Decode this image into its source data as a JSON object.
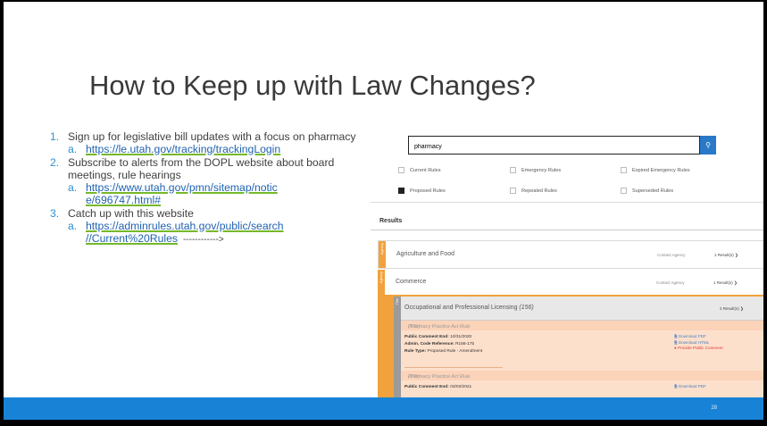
{
  "slide": {
    "title": "How to Keep up with Law Changes?",
    "page_number": "28",
    "items": [
      {
        "num": "1.",
        "text": "Sign up for legislative bill updates with a focus on pharmacy",
        "sub_num": "a.",
        "link": "https://le.utah.gov/tracking/trackingLogin"
      },
      {
        "num": "2.",
        "text": "Subscribe to alerts from the DOPL website about board meetings, rule hearings",
        "sub_num": "a.",
        "link_line1": "https://www.utah.gov/pmn/sitemap/notic",
        "link_line2": "e/696747.html#"
      },
      {
        "num": "3.",
        "text": "Catch up with this website",
        "sub_num": "a.",
        "link_line1": "https://adminrules.utah.gov/public/search",
        "link_line2": "//Current%20Rules",
        "arrow": "------------>"
      }
    ]
  },
  "screenshot": {
    "search_value": "pharmacy",
    "search_icon": "search-icon",
    "checkboxes": [
      {
        "label": "Current Rules",
        "checked": false
      },
      {
        "label": "Emergency Rules",
        "checked": false
      },
      {
        "label": "Expired Emergency Rules",
        "checked": false
      },
      {
        "label": "Proposed Rules",
        "checked": true
      },
      {
        "label": "Repealed Rules",
        "checked": false
      },
      {
        "label": "Superseded Rules",
        "checked": false
      }
    ],
    "results_heading": "Results",
    "agency_tab_label": "Agency",
    "title_tab_label": "Title",
    "agencies": [
      {
        "name": "Agriculture and Food",
        "contact": "Contact Agency",
        "count": "1 Result(s)"
      },
      {
        "name": "Commerce",
        "contact": "Contact Agency",
        "count": "1 Result(s)"
      }
    ],
    "sub_agency": {
      "name": "Occupational and Professional Licensing",
      "count_inline": "(156)",
      "count": "2 Result(s)"
    },
    "rules": [
      {
        "title": "Pharmacy Practice Act Rule",
        "code_inline": "(17b)",
        "comment_label": "Public Comment End:",
        "comment_end": "10/31/2020",
        "ref_label": "Admin. Code Reference:",
        "ref": "R156-17b",
        "type_label": "Rule Type:",
        "type": "Proposed Rule - Amendment",
        "actions": [
          "Download PDF",
          "Download HTML",
          "Provide Public Comment"
        ]
      },
      {
        "title": "Pharmacy Practice Act Rule",
        "code_inline": "(17b)",
        "comment_label": "Public Comment End:",
        "comment_end": "03/03/2021",
        "actions": [
          "Download PDF"
        ]
      }
    ]
  },
  "colors": {
    "accent_blue": "#1883d6",
    "agency_orange": "#f2a23c",
    "link_underline": "#76b82a",
    "rule_bg": "#fde0cc"
  }
}
